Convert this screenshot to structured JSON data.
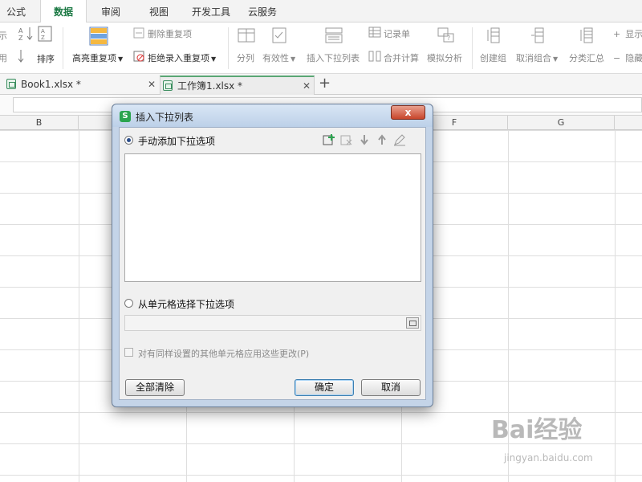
{
  "menu": {
    "tabs": [
      {
        "label": "公式"
      },
      {
        "label": "数据",
        "active": true
      },
      {
        "label": "审阅"
      },
      {
        "label": "视图"
      },
      {
        "label": "开发工具"
      },
      {
        "label": "云服务"
      }
    ]
  },
  "ribbon": {
    "partial_left_top": "示",
    "partial_left_bottom": "用",
    "sort_label": "排序",
    "highlight_duplicates": "高亮重复项",
    "delete_duplicates": "删除重复项",
    "reject_duplicates": "拒绝录入重复项",
    "split_columns": "分列",
    "validity": "有效性",
    "insert_dropdown": "插入下拉列表",
    "record_form": "记录单",
    "merge_calc": "合并计算",
    "what_if": "模拟分析",
    "create_group": "创建组",
    "ungroup": "取消组合",
    "subtotal": "分类汇总",
    "show_detail": "显示",
    "hide_detail": "隐藏"
  },
  "doc_tabs": [
    {
      "label": "Book1.xlsx *"
    },
    {
      "label": "工作簿1.xlsx *",
      "active": true
    }
  ],
  "grid": {
    "columns": [
      "B",
      "F",
      "G"
    ]
  },
  "dialog": {
    "title": "插入下拉列表",
    "close_label": "x",
    "option_manual": "手动添加下拉选项",
    "option_cells": "从单元格选择下拉选项",
    "apply_same": "对有同样设置的其他单元格应用这些更改(P)",
    "clear_all": "全部清除",
    "ok": "确定",
    "cancel": "取消"
  },
  "watermark": {
    "brand": "Bai经验",
    "url": "jingyan.baidu.com"
  },
  "colors": {
    "accent_green": "#1d7a45",
    "dialog_frame": "#c4d4e8",
    "close_red": "#c8452b"
  }
}
